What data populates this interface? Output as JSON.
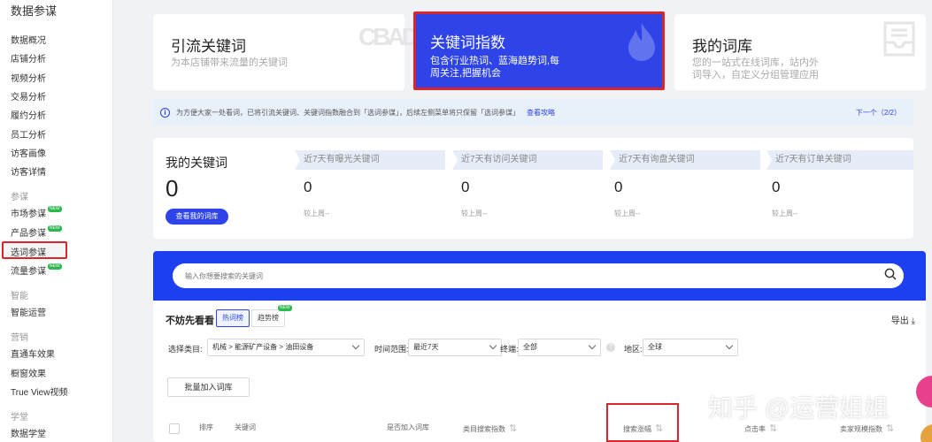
{
  "sidebar": {
    "title": "数据参谋",
    "items": [
      {
        "label": "数据概况",
        "new": false
      },
      {
        "label": "店铺分析",
        "new": false
      },
      {
        "label": "视频分析",
        "new": false
      },
      {
        "label": "交易分析",
        "new": false
      },
      {
        "label": "履约分析",
        "new": false
      },
      {
        "label": "员工分析",
        "new": false
      },
      {
        "label": "访客画像",
        "new": false
      },
      {
        "label": "访客详情",
        "new": false
      }
    ],
    "groups": [
      {
        "title": "参谋",
        "items": [
          {
            "label": "市场参谋",
            "new": true
          },
          {
            "label": "产品参谋",
            "new": true
          },
          {
            "label": "选词参谋",
            "new": false,
            "active": true
          },
          {
            "label": "流量参谋",
            "new": true
          }
        ]
      },
      {
        "title": "智能",
        "items": [
          {
            "label": "智能运营",
            "new": false
          }
        ]
      },
      {
        "title": "营销",
        "items": [
          {
            "label": "直通车效果",
            "new": false
          },
          {
            "label": "橱窗效果",
            "new": false
          },
          {
            "label": "True View视频",
            "new": false
          }
        ]
      },
      {
        "title": "学堂",
        "items": [
          {
            "label": "数据学堂",
            "new": false
          }
        ]
      }
    ],
    "new_badge": "NEW"
  },
  "cards": [
    {
      "title": "引流关键词",
      "desc": "为本店铺带来流量的关键词",
      "deco": "CBAD"
    },
    {
      "title": "关键词指数",
      "desc_line1": "包含行业热词、蓝海趋势词,每",
      "desc_line2": "周关注,把握机会"
    },
    {
      "title": "我的词库",
      "desc_line1": "您的一站式在线词库，站内外",
      "desc_line2": "词导入，自定义分组管理应用"
    }
  ],
  "info": {
    "text": "为方便大家一处看词，已将引流关键词、关键词指数融合到「选词参谋」，后续左侧菜单将只保留「选词参谋」",
    "link": "查看攻略",
    "next": "下一个（2/2）"
  },
  "my_keywords": {
    "title": "我的关键词",
    "count": "0",
    "button": "查看我的词库",
    "stats": [
      {
        "label": "近7天有曝光关键词",
        "value": "0",
        "compare": "较上周--"
      },
      {
        "label": "近7天有访问关键词",
        "value": "0",
        "compare": "较上周--"
      },
      {
        "label": "近7天有询盘关键词",
        "value": "0",
        "compare": "较上周--"
      },
      {
        "label": "近7天有订单关键词",
        "value": "0",
        "compare": "较上周--"
      }
    ]
  },
  "search": {
    "placeholder": "输入你想要搜索的关键词",
    "try_label": "不妨先看看",
    "tabs": [
      "热词榜",
      "趋势榜"
    ],
    "tab_new": "NEW",
    "export": "导出",
    "filters": {
      "category_label": "选择类目:",
      "category_value": "机械 > 能源矿产设备 > 油田设备",
      "time_label": "时间范围:",
      "time_value": "最近7天",
      "terminal_label": "终端:",
      "terminal_value": "全部",
      "region_label": "地区:",
      "region_value": "全球"
    },
    "batch_button": "批量加入词库",
    "columns": [
      "排序",
      "关键词",
      "是否加入词库",
      "类目搜索指数",
      "搜索涨幅",
      "点击率",
      "卖家规模指数"
    ]
  },
  "watermark": "知乎 @运营姐姐",
  "colors": {
    "accent": "#2e44e8",
    "highlight": "#d9262c",
    "new_badge": "#2db84d"
  }
}
